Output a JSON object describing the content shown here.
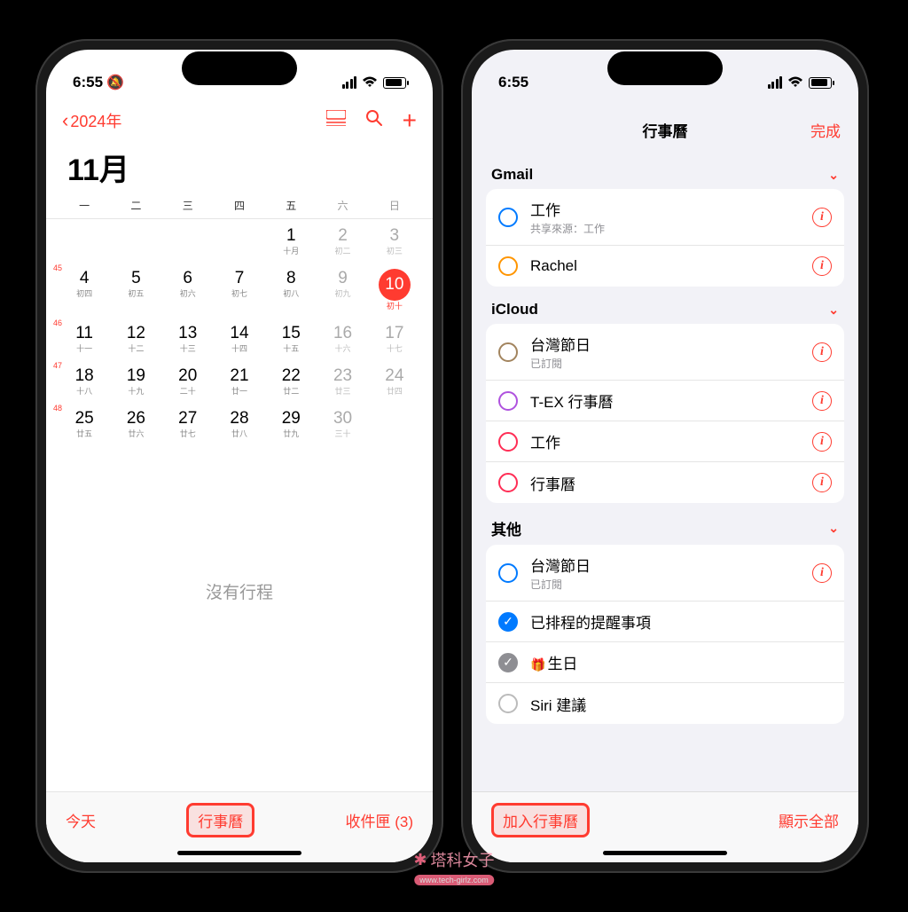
{
  "status": {
    "time_left": "6:55",
    "time_right": "6:55",
    "silent": "🔕"
  },
  "left": {
    "nav": {
      "back": "2024年",
      "list_icon": "☰",
      "search_icon": "🔍",
      "add_icon": "＋"
    },
    "month": "11月",
    "weekdays": [
      "一",
      "二",
      "三",
      "四",
      "五",
      "六",
      "日"
    ],
    "weeks": [
      {
        "num": "",
        "cells": [
          null,
          null,
          null,
          null,
          {
            "d": "1",
            "s": "十月"
          },
          {
            "d": "2",
            "s": "初二",
            "w": true
          },
          {
            "d": "3",
            "s": "初三",
            "w": true
          }
        ]
      },
      {
        "num": "45",
        "cells": [
          {
            "d": "4",
            "s": "初四"
          },
          {
            "d": "5",
            "s": "初五"
          },
          {
            "d": "6",
            "s": "初六"
          },
          {
            "d": "7",
            "s": "初七"
          },
          {
            "d": "8",
            "s": "初八"
          },
          {
            "d": "9",
            "s": "初九",
            "w": true
          },
          {
            "d": "10",
            "s": "初十",
            "w": true,
            "today": true
          }
        ]
      },
      {
        "num": "46",
        "cells": [
          {
            "d": "11",
            "s": "十一"
          },
          {
            "d": "12",
            "s": "十二"
          },
          {
            "d": "13",
            "s": "十三"
          },
          {
            "d": "14",
            "s": "十四"
          },
          {
            "d": "15",
            "s": "十五"
          },
          {
            "d": "16",
            "s": "十六",
            "w": true
          },
          {
            "d": "17",
            "s": "十七",
            "w": true
          }
        ]
      },
      {
        "num": "47",
        "cells": [
          {
            "d": "18",
            "s": "十八"
          },
          {
            "d": "19",
            "s": "十九"
          },
          {
            "d": "20",
            "s": "二十"
          },
          {
            "d": "21",
            "s": "廿一"
          },
          {
            "d": "22",
            "s": "廿二"
          },
          {
            "d": "23",
            "s": "廿三",
            "w": true
          },
          {
            "d": "24",
            "s": "廿四",
            "w": true
          }
        ]
      },
      {
        "num": "48",
        "cells": [
          {
            "d": "25",
            "s": "廿五"
          },
          {
            "d": "26",
            "s": "廿六"
          },
          {
            "d": "27",
            "s": "廿七"
          },
          {
            "d": "28",
            "s": "廿八"
          },
          {
            "d": "29",
            "s": "廿九"
          },
          {
            "d": "30",
            "s": "三十",
            "w": true
          },
          null
        ]
      }
    ],
    "no_events": "沒有行程",
    "toolbar": {
      "today": "今天",
      "calendars": "行事曆",
      "inbox": "收件匣 (3)"
    }
  },
  "right": {
    "header": {
      "title": "行事曆",
      "done": "完成"
    },
    "sections": [
      {
        "name": "Gmail",
        "items": [
          {
            "circle": "blue",
            "title": "工作",
            "sub": "共享來源：工作",
            "info": true
          },
          {
            "circle": "orange",
            "title": "Rachel",
            "info": true
          }
        ]
      },
      {
        "name": "iCloud",
        "items": [
          {
            "circle": "brown",
            "title": "台灣節日",
            "sub": "已訂閱",
            "info": true
          },
          {
            "circle": "purple",
            "title": "T-EX 行事曆",
            "info": true
          },
          {
            "circle": "red",
            "title": "工作",
            "info": true
          },
          {
            "circle": "red",
            "title": "行事曆",
            "info": true
          }
        ]
      },
      {
        "name": "其他",
        "items": [
          {
            "circle": "blue",
            "title": "台灣節日",
            "sub": "已訂閱",
            "info": true
          },
          {
            "checked": "blue",
            "title": "已排程的提醒事項"
          },
          {
            "checked": "gray",
            "gift": true,
            "title": "生日"
          },
          {
            "circle": "gray",
            "title": "Siri 建議"
          }
        ]
      }
    ],
    "toolbar": {
      "add": "加入行事曆",
      "show_all": "顯示全部"
    }
  },
  "watermark": {
    "text": "塔科女子",
    "url": "www.tech-girlz.com"
  }
}
